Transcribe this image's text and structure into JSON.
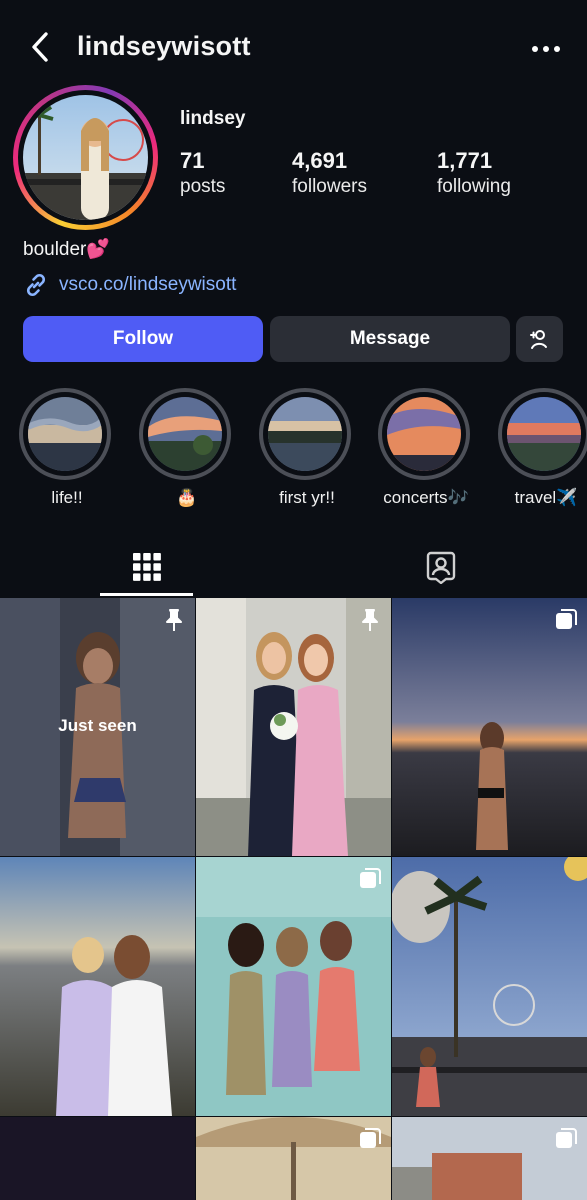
{
  "header": {
    "username": "lindseywisott"
  },
  "profile": {
    "display_name": "lindsey",
    "bio": "boulder💕",
    "link": "vsco.co/lindseywisott",
    "stats": [
      {
        "value": "71",
        "label": "posts"
      },
      {
        "value": "4,691",
        "label": "followers"
      },
      {
        "value": "1,771",
        "label": "following"
      }
    ]
  },
  "actions": {
    "follow": "Follow",
    "message": "Message"
  },
  "highlights": [
    {
      "label": "life!!"
    },
    {
      "label": "🎂"
    },
    {
      "label": "first yr!!"
    },
    {
      "label": "concerts🎶"
    },
    {
      "label": "travel✈️"
    }
  ],
  "grid": {
    "tiles": [
      {
        "badge": "pin",
        "overlay": "Just seen"
      },
      {
        "badge": "pin"
      },
      {
        "badge": "multi"
      },
      {
        "badge": ""
      },
      {
        "badge": "multi"
      },
      {
        "badge": ""
      },
      {
        "badge": ""
      },
      {
        "badge": "multi"
      },
      {
        "badge": "multi"
      }
    ]
  },
  "colors": {
    "background": "#0b0e14",
    "follow_button": "#4f5cf5",
    "secondary_button": "#2b2e36",
    "link": "#8ab4ff"
  }
}
